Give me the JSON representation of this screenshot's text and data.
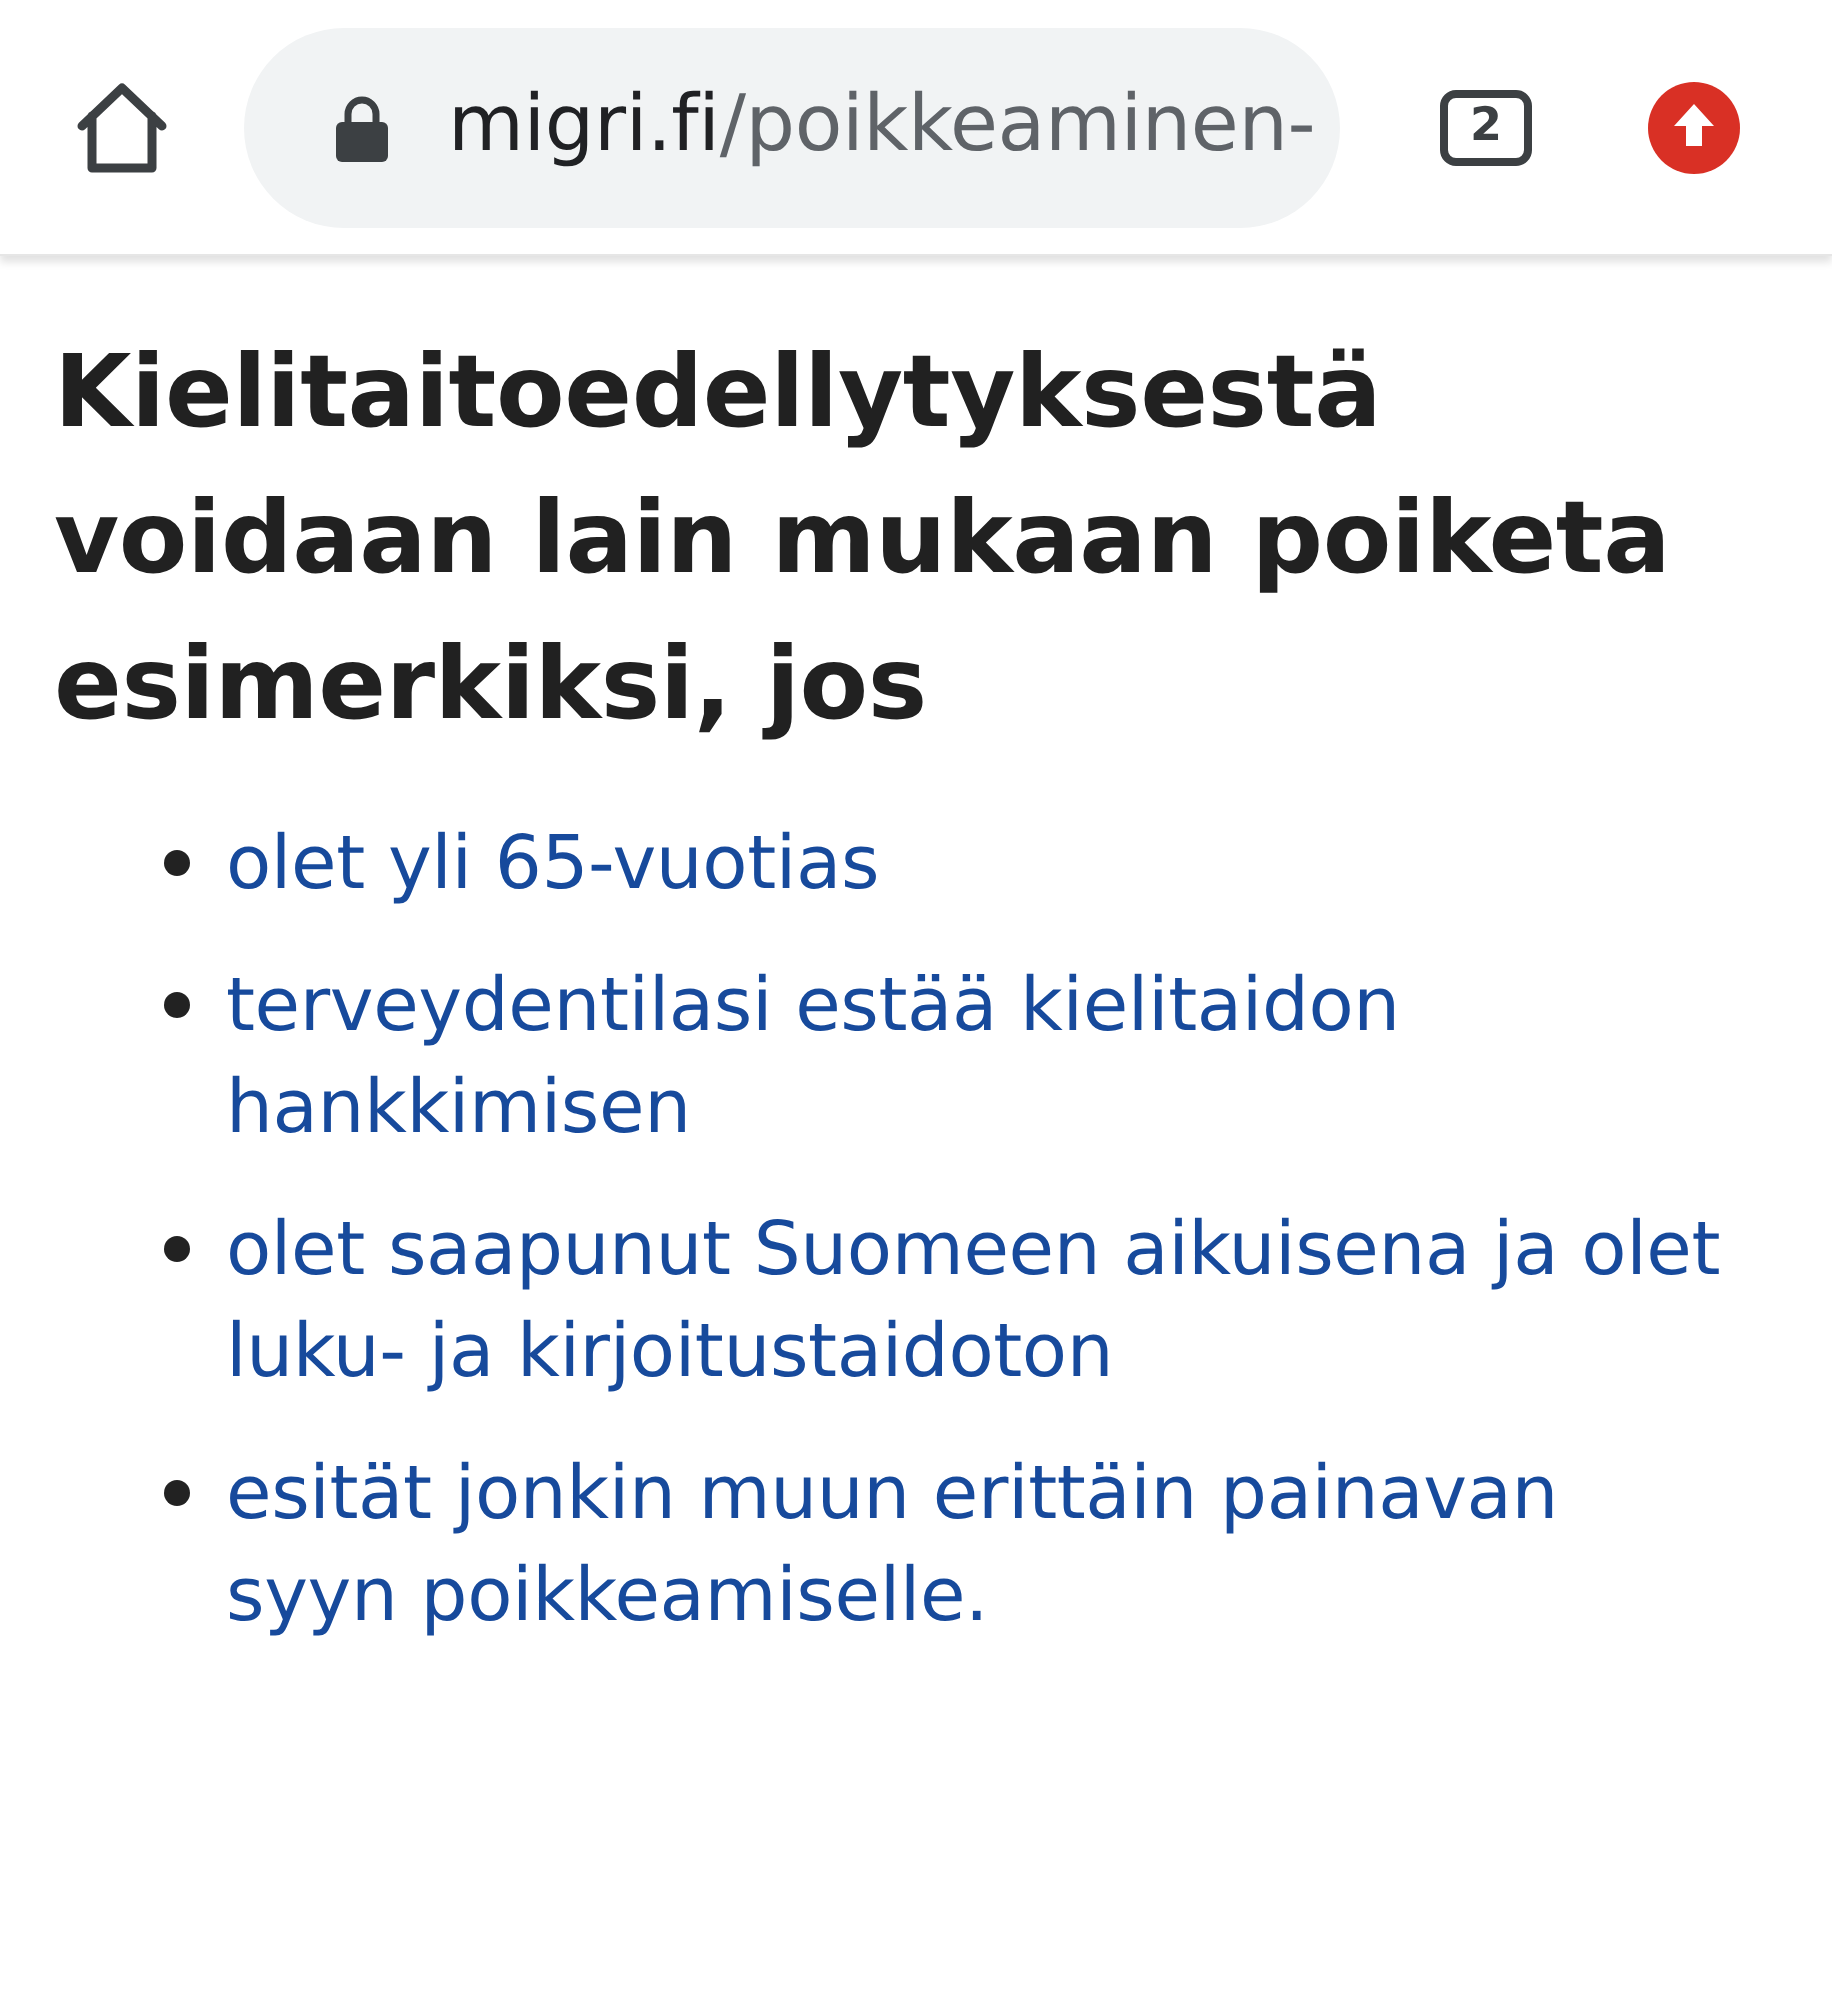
{
  "toolbar": {
    "url": {
      "host": "migri.fi",
      "path": "/poikkeaminen-"
    },
    "secure": true,
    "tab_count": "2"
  },
  "heading": "Kielitaitoedellytyksestä voidaan lain mukaan poiketa esimerkiksi, jos",
  "items": [
    "olet yli 65-vuotias",
    "terveydentilasi estää kielitaidon hankkimisen",
    "olet saapunut Suomeen aikuisena ja olet luku- ja kirjoitustaidoton",
    "esität jonkin muun erittäin painavan syyn poikkeamiselle."
  ]
}
